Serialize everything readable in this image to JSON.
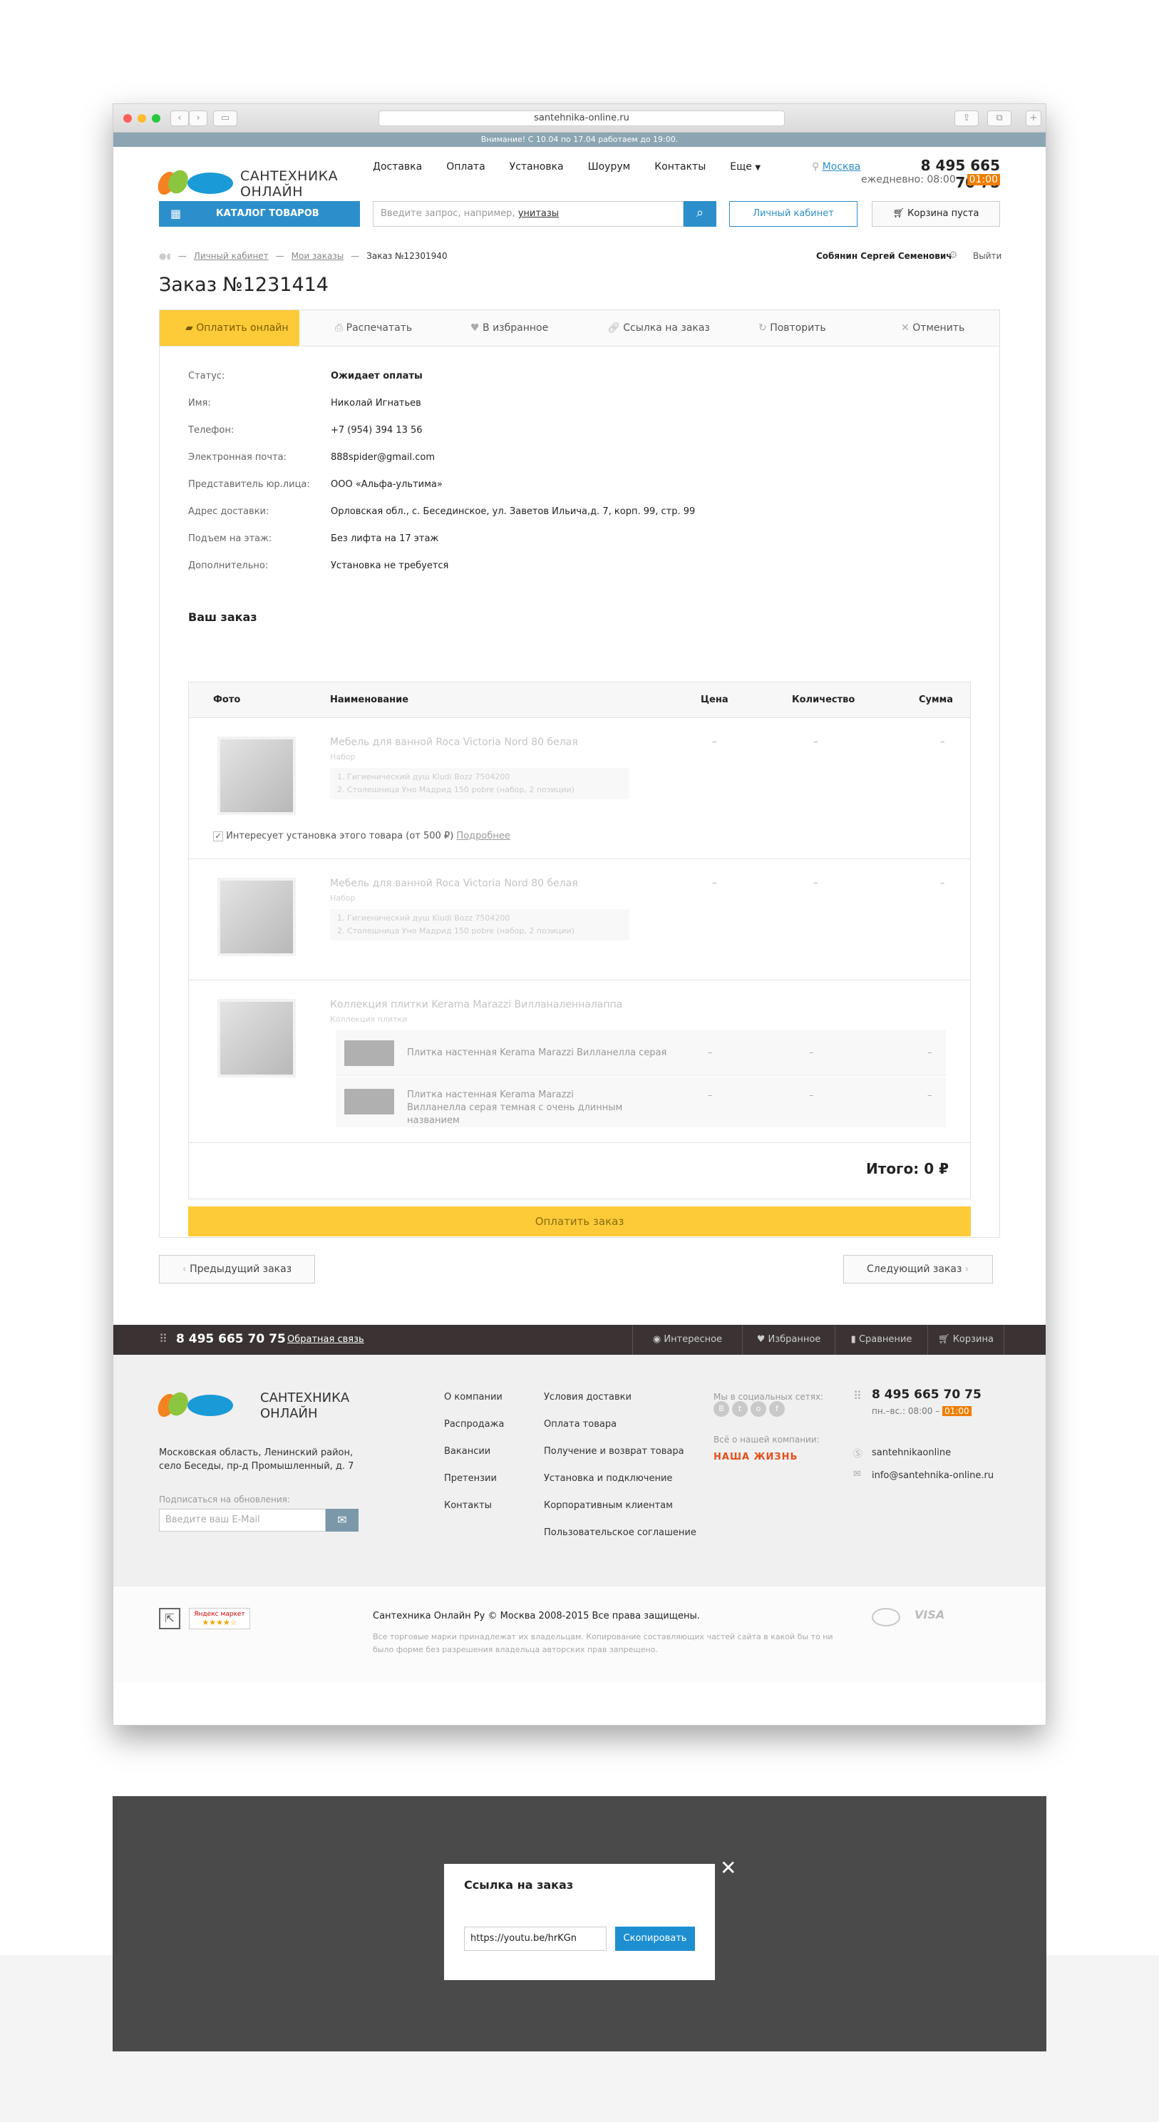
{
  "browser": {
    "url": "santehnika-online.ru"
  },
  "notice": "Внимание! С 10.04 по 17.04 работаем до 19:00.",
  "header": {
    "logo_line1": "САНТЕХНИКА",
    "logo_line2": "ОНЛАЙН",
    "nav": [
      "Доставка",
      "Оплата",
      "Установка",
      "Шоурум",
      "Контакты",
      "Еще"
    ],
    "city": "Москва",
    "phone": "8 495 665 70 75",
    "hours": "ежедневно: 08:00 –",
    "hours_end": "01:00",
    "catalog_button": "КАТАЛОГ ТОВАРОВ",
    "search_placeholder": "Введите запрос, например,",
    "search_example": "унитазы",
    "account_button": "Личный кабинет",
    "cart": "Корзина пуста"
  },
  "breadcrumb": {
    "items": [
      "Личный кабинет",
      "Мои заказы"
    ],
    "current": "Заказ №12301940"
  },
  "user": {
    "name": "Собянин Сергей Семенович",
    "logout": "Выйти"
  },
  "page_title": "Заказ №1231414",
  "tabs": [
    "Оплатить онлайн",
    "Распечатать",
    "В избранное",
    "Ссылка на заказ",
    "Повторить",
    "Отменить"
  ],
  "details": [
    {
      "label": "Статус:",
      "value": "Ожидает оплаты"
    },
    {
      "label": "Имя:",
      "value": "Николай Игнатьев"
    },
    {
      "label": "Телефон:",
      "value": "+7 (954) 394 13 56"
    },
    {
      "label": "Электронная почта:",
      "value": "888spider@gmail.com"
    },
    {
      "label": "Представитель юр.лица:",
      "value": "ООО «Альфа-ультима»"
    },
    {
      "label": "Адрес доставки:",
      "value": "Орловская обл., с. Бесединское, ул. Заветов Ильича,д. 7, корп. 99, стр. 99"
    },
    {
      "label": "Подъем на этаж:",
      "value": "Без лифта на 17 этаж"
    },
    {
      "label": "Дополнительно:",
      "value": "Установка не требуется"
    }
  ],
  "order": {
    "heading": "Ваш заказ",
    "columns": [
      "Фото",
      "Наименование",
      "Цена",
      "Количество",
      "Сумма"
    ],
    "dash": "–",
    "items": [
      {
        "name": "Мебель для ванной Roca Victoria Nord 80 белая",
        "type": "Набор",
        "parts": [
          "1. Гигиенический душ Kludi Bozz 7504200",
          "2. Столешница Уно Мадрид 150 pobre (набор, 2 позиции)"
        ]
      },
      {
        "name": "Мебель для ванной Roca Victoria Nord 80 белая",
        "type": "Набор",
        "parts": [
          "1. Гигиенический душ Kludi Bozz 7504200",
          "2. Столешница Уно Мадрид 150 pobre (набор, 2 позиции)"
        ]
      },
      {
        "name": "Коллекция плитки Kerama Marazzi Вилланаленналаппа",
        "type": "Коллекция плитки",
        "subitems": [
          "Плитка настенная Kerama Marazzi Вилланелла серая",
          "Плитка настенная Kerama Marazzi Вилланелла серая темная с очень длинным названием"
        ]
      }
    ],
    "install_text": "Интересует установка этого товара (от 500 ₽)",
    "install_more": "Подробнее",
    "total": "Итого: 0 ₽",
    "pay_button": "Оплатить заказ"
  },
  "pager": {
    "prev": "Предыдущий заказ",
    "next": "Следующий заказ"
  },
  "footer_bar": {
    "phone": "8 495 665 70 75",
    "feedback": "Обратная связь",
    "links": [
      "Интересное",
      "Избранное",
      "Сравнение",
      "Корзина"
    ]
  },
  "footer": {
    "address": "Московская область, Ленинский район, село Беседы, пр-д Промышленный, д. 7",
    "subscribe_label": "Подписаться на обновления:",
    "email_placeholder": "Введите ваш E-Mail",
    "col1": [
      "О компании",
      "Распродажа",
      "Вакансии",
      "Претензии",
      "Контакты"
    ],
    "col2": [
      "Условия доставки",
      "Оплата товара",
      "Получение и возврат товара",
      "Установка и подключение",
      "Корпоративным клиентам",
      "Пользовательское соглашение"
    ],
    "social_label": "Мы в социальных сетях:",
    "about_label": "Всё о нашей компании:",
    "about_brand": "НАША ЖИЗНЬ",
    "phone": "8 495 665 70 75",
    "hours": "пн.–вс.: 08:00 –",
    "hours_end": "01:00",
    "skype": "santehnikaonline",
    "email": "info@santehnika-online.ru"
  },
  "legal": {
    "yandex": "Яндекс маркет",
    "copyright": "Сантехника Онлайн Ру © Москва 2008-2015 Все права защищены.",
    "notice": "Все торговые марки принадлежат их владельцам. Копирование составляющих частей сайта в какой бы то ни было форме без разрешения владельца авторских прав запрещено.",
    "visa": "VISA"
  },
  "modal": {
    "title": "Ссылка на заказ",
    "url": "https://youtu.be/hrKGn",
    "copy_button": "Скопировать"
  },
  "colors": {
    "accent_blue": "#2c8fcb",
    "yellow": "#fecb38",
    "orange": "#f07d00",
    "footer_dark": "#3b3333"
  }
}
